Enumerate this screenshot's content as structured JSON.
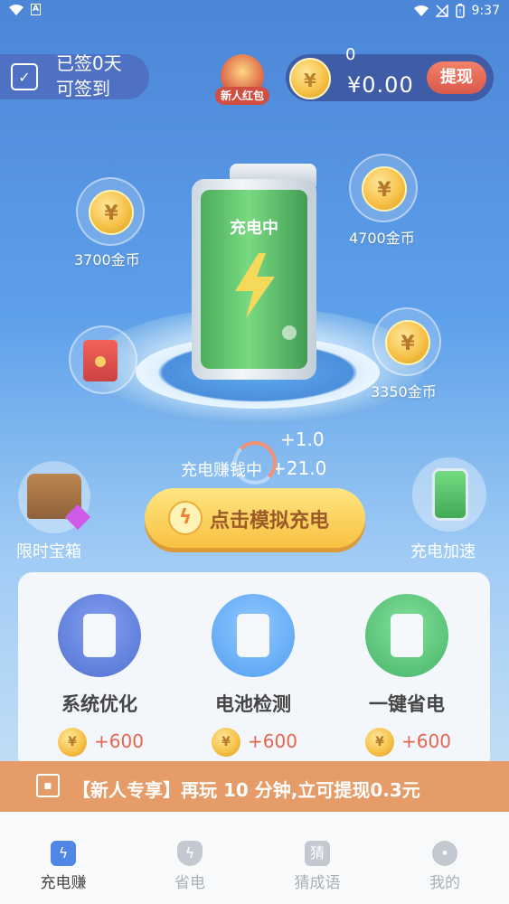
{
  "status_bar": {
    "time": "9:37",
    "left_icons": [
      "wifi-icon",
      "a-icon"
    ],
    "right_icons": [
      "wifi-icon",
      "no-signal-icon",
      "battery-icon"
    ]
  },
  "checkin": {
    "line1": "已签0天",
    "line2": "可签到"
  },
  "new_user_red_packet": {
    "label": "新人红包"
  },
  "wallet": {
    "coins": "0",
    "cash": "¥0.00",
    "withdraw_label": "提现",
    "coin_symbol": "¥"
  },
  "floating_coins": [
    {
      "amount": "3700金币"
    },
    {
      "amount": "4700金币"
    },
    {
      "amount": "3350金币"
    }
  ],
  "battery": {
    "status": "充电中"
  },
  "earning": {
    "label": "充电赚钱中",
    "plus_small": "+1.0",
    "plus_big": "+21.0"
  },
  "main_button": {
    "label": "点击模拟充电"
  },
  "side_actions": {
    "left": "限时宝箱",
    "right": "充电加速"
  },
  "features": [
    {
      "name": "系统优化",
      "reward": "+600",
      "color": "#2e56c8"
    },
    {
      "name": "电池检测",
      "reward": "+600",
      "color": "#2f8cf0"
    },
    {
      "name": "一键省电",
      "reward": "+600",
      "color": "#21a64a"
    }
  ],
  "banner": {
    "text": "【新人专享】再玩 10 分钟,立可提现0.3元"
  },
  "tabs": [
    {
      "label": "充电赚",
      "icon": "bolt-icon",
      "active": true
    },
    {
      "label": "省电",
      "icon": "shield-bolt-icon",
      "active": false
    },
    {
      "label": "猜成语",
      "icon": "guess-icon",
      "glyph": "猜",
      "active": false
    },
    {
      "label": "我的",
      "icon": "user-icon",
      "active": false
    }
  ]
}
